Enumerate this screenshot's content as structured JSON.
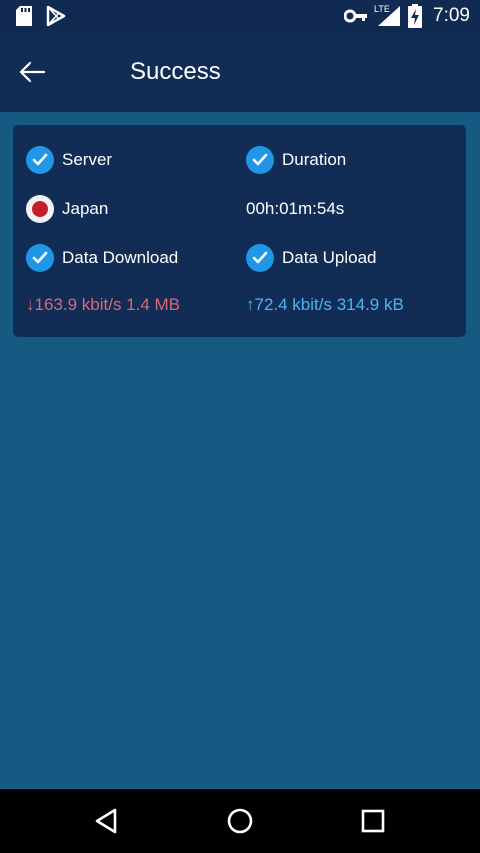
{
  "status_bar": {
    "time": "7:09",
    "network_label": "LTE",
    "icons": [
      "sd-card-icon",
      "play-store-icon",
      "vpn-key-icon",
      "signal-icon",
      "battery-charging-icon"
    ]
  },
  "app_bar": {
    "title": "Success",
    "back_icon": "arrow-left-icon"
  },
  "card": {
    "server_label": "Server",
    "duration_label": "Duration",
    "server_value": "Japan",
    "duration_value": "00h:01m:54s",
    "download_label": "Data Download",
    "upload_label": "Data Upload",
    "download_value": "↓163.9 kbit/s 1.4 MB",
    "upload_value": "↑72.4 kbit/s 314.9 kB"
  },
  "nav_bar": {
    "buttons": [
      "back-triangle-icon",
      "home-circle-icon",
      "recents-square-icon"
    ]
  },
  "colors": {
    "background": "#155a82",
    "app_bar": "#112d56",
    "card": "#112d56",
    "check": "#2196e6",
    "download": "#d9667a",
    "upload": "#4fb3f0"
  }
}
